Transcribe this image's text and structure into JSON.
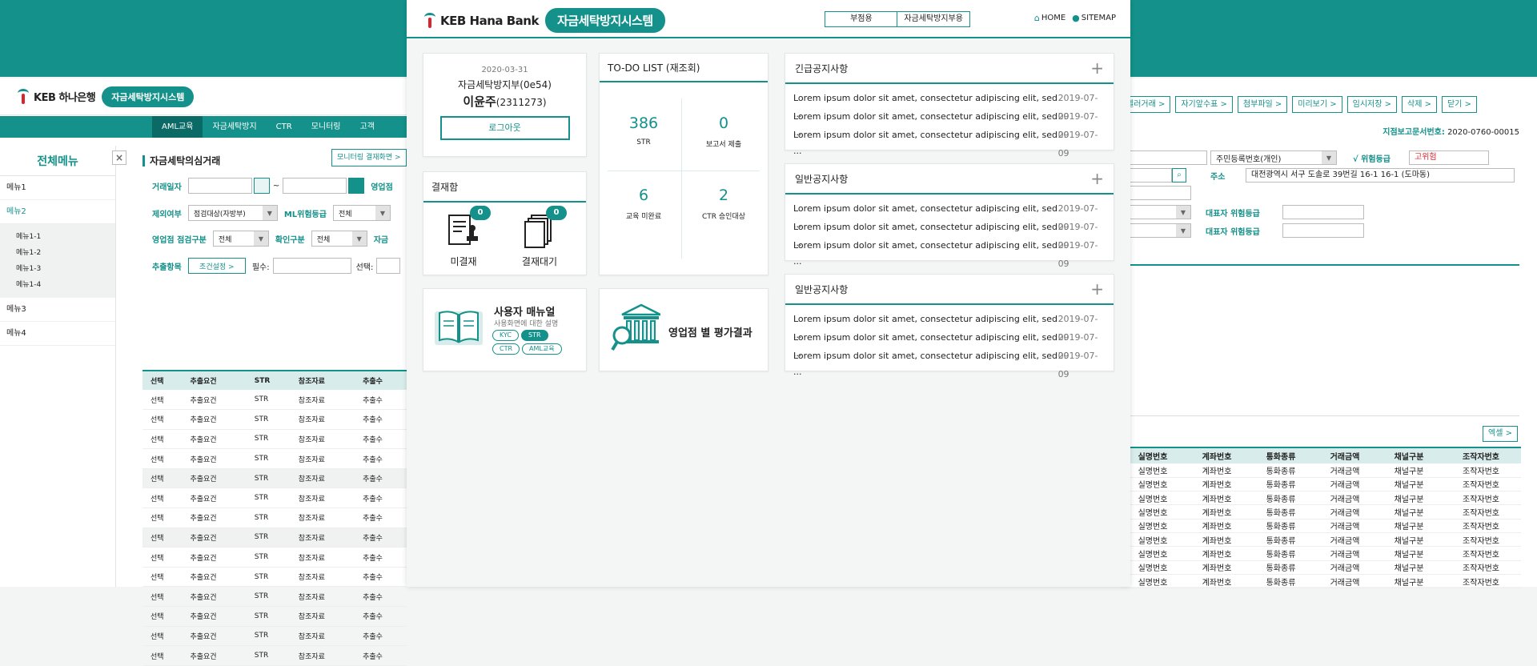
{
  "colors": {
    "accent": "#14918a",
    "risk": "#d8242d"
  },
  "left_window": {
    "logo": "KEB 하나은행",
    "system_name": "자금세탁방지시스템",
    "nav": [
      "AML교육",
      "자금세탁방지",
      "CTR",
      "모니터링",
      "고객"
    ],
    "sidebar": {
      "title": "전체메뉴",
      "close_icon": "close-icon",
      "items": [
        "메뉴1",
        "메뉴2",
        "메뉴3",
        "메뉴4"
      ],
      "subitems": [
        "메뉴1-1",
        "메뉴1-2",
        "메뉴1-3",
        "메뉴1-4"
      ]
    },
    "section_title": "자금세탁의심거래",
    "monitor_button": "모니터링 결재화면 >",
    "filters": {
      "trade_date": "거래일자",
      "tilde": "~",
      "branch": "영업점",
      "exclude": "제외여부",
      "exclude_value": "점검대상(자방부)",
      "ml_grade": "ML위험등급",
      "ml_grade_value": "전체",
      "branch_check": "영업점 점검구분",
      "branch_check_value": "전체",
      "confirm": "확인구분",
      "confirm_value": "전체",
      "jachae": "자금",
      "extract": "추출항목",
      "condition_btn": "조건설정 >",
      "required": "필수:",
      "optional": "선택:"
    },
    "table": {
      "headers": [
        "선택",
        "추출요건",
        "STR",
        "참조자료",
        "추출수"
      ],
      "row": [
        "선택",
        "추출요건",
        "STR",
        "참조자료",
        "추출수"
      ],
      "row_count": 14
    }
  },
  "center_window": {
    "logo": "KEB Hana Bank",
    "system_name": "자금세탁방지시스템",
    "util_links": [
      "부점용",
      "자금세탁방지부용"
    ],
    "home": "HOME",
    "sitemap": "SITEMAP",
    "user": {
      "date": "2020-03-31",
      "dept": "자금세탁방지부(0e54)",
      "name": "이윤주",
      "id": "(2311273)",
      "logout": "로그아웃"
    },
    "approval": {
      "title": "결재함",
      "items": [
        {
          "label": "미결재",
          "count": "0",
          "icon": "document-stamp-icon"
        },
        {
          "label": "결재대기",
          "count": "0",
          "icon": "document-stack-icon"
        }
      ]
    },
    "manual": {
      "title": "사용자 매뉴얼",
      "subtitle": "사용화면에 대한 설명",
      "tags": [
        "KYC",
        "STR",
        "CTR",
        "AML교육"
      ],
      "icon": "open-book-icon"
    },
    "todo": {
      "title": "TO-DO LIST (재조회)",
      "cells": [
        {
          "num": "386",
          "label": "STR"
        },
        {
          "num": "0",
          "label": "보고서 제출"
        },
        {
          "num": "6",
          "label": "교육 미완료"
        },
        {
          "num": "2",
          "label": "CTR 승인대상"
        }
      ]
    },
    "eval": {
      "title": "영업점 별 평가결과",
      "icon": "bank-magnifier-icon"
    },
    "notices": [
      {
        "title": "긴급공지사항",
        "items": [
          {
            "text": "Lorem ipsum dolor sit amet, consectetur adipiscing elit, sed ···",
            "date": "2019-07-09"
          },
          {
            "text": "Lorem ipsum dolor sit amet, consectetur adipiscing elit, sed ···",
            "date": "2019-07-09"
          },
          {
            "text": "Lorem ipsum dolor sit amet, consectetur adipiscing elit, sed ···",
            "date": "2019-07-09"
          }
        ]
      },
      {
        "title": "일반공지사항",
        "items": [
          {
            "text": "Lorem ipsum dolor sit amet, consectetur adipiscing elit, sed ···",
            "date": "2019-07-09"
          },
          {
            "text": "Lorem ipsum dolor sit amet, consectetur adipiscing elit, sed ···",
            "date": "2019-07-09"
          },
          {
            "text": "Lorem ipsum dolor sit amet, consectetur adipiscing elit, sed ···",
            "date": "2019-07-09"
          }
        ]
      },
      {
        "title": "일반공지사항",
        "items": [
          {
            "text": "Lorem ipsum dolor sit amet, consectetur adipiscing elit, sed ···",
            "date": "2019-07-09"
          },
          {
            "text": "Lorem ipsum dolor sit amet, consectetur adipiscing elit, sed ···",
            "date": "2019-07-09"
          },
          {
            "text": "Lorem ipsum dolor sit amet, consectetur adipiscing elit, sed ···",
            "date": "2019-07-09"
          }
        ]
      }
    ]
  },
  "right_window": {
    "buttons": [
      "텔러거래 >",
      "자기앞수표 >",
      "첨부파일 >",
      "미리보기 >",
      "임시저장 >",
      "삭제 >",
      "닫기 >"
    ],
    "doc_label": "지점보고문서번호:",
    "doc_number": "2020-0760-00015",
    "id_type": "주민등록번호(개인)",
    "risk_label": "√ 위험등급",
    "risk_value": "고위험",
    "address_label": "주소",
    "address_value": "대전광역시 서구 도솔로 39번길 16-1 16-1 (도마동)",
    "rep_risk_label": "대표자 위험등급",
    "excel_btn": "엑셀 >",
    "table": {
      "headers": [
        "실명번호",
        "계좌번호",
        "통화종류",
        "거래금액",
        "채널구분",
        "조작자번호"
      ],
      "row": [
        "실명번호",
        "계좌번호",
        "통화종류",
        "거래금액",
        "채널구분",
        "조작자번호"
      ],
      "row_count": 9
    }
  }
}
